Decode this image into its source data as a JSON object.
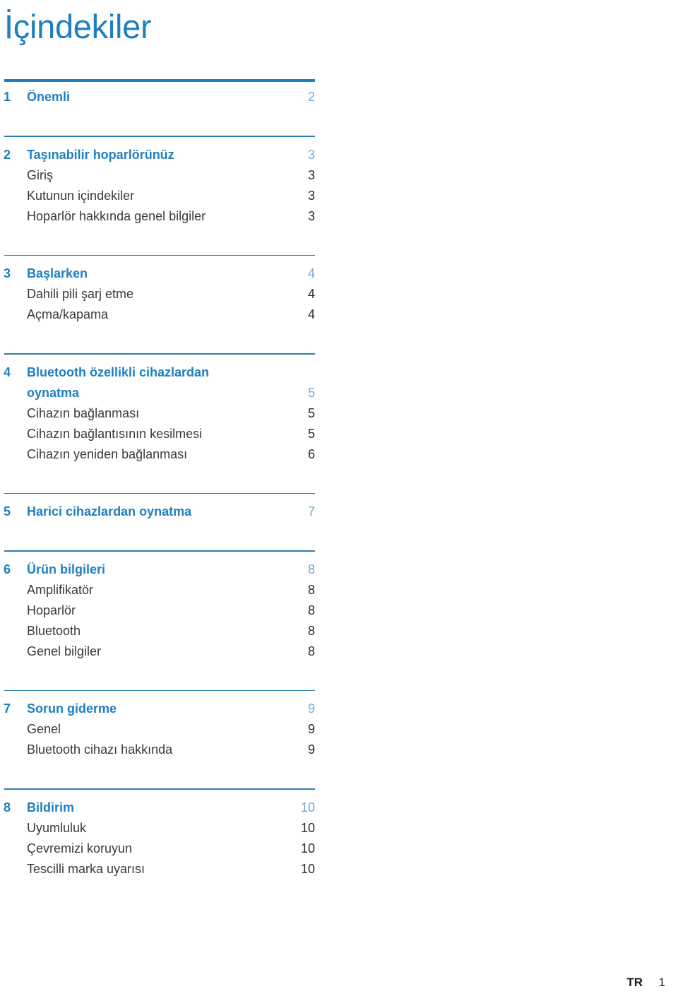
{
  "document": {
    "title": "İçindekiler",
    "accent_color": "#1f7fbf",
    "sub_text_color": "#3a3a3a",
    "chapter_page_color": "#6ea9cc"
  },
  "sections": [
    {
      "number": "1",
      "title": "Önemli",
      "page": "2",
      "title_line2": "",
      "entries": []
    },
    {
      "number": "2",
      "title": "Taşınabilir hoparlörünüz",
      "page": "3",
      "title_line2": "",
      "entries": [
        {
          "label": "Giriş",
          "page": "3"
        },
        {
          "label": "Kutunun içindekiler",
          "page": "3"
        },
        {
          "label": "Hoparlör hakkında genel bilgiler",
          "page": "3"
        }
      ]
    },
    {
      "number": "3",
      "title": "Başlarken",
      "page": "4",
      "title_line2": "",
      "entries": [
        {
          "label": "Dahili pili şarj etme",
          "page": "4"
        },
        {
          "label": "Açma/kapama",
          "page": "4"
        }
      ]
    },
    {
      "number": "4",
      "title": "Bluetooth özellikli cihazlardan",
      "title_line2": "oynatma",
      "page": "5",
      "entries": [
        {
          "label": "Cihazın bağlanması",
          "page": "5"
        },
        {
          "label": "Cihazın bağlantısının kesilmesi",
          "page": "5"
        },
        {
          "label": "Cihazın yeniden bağlanması",
          "page": "6"
        }
      ]
    },
    {
      "number": "5",
      "title": "Harici cihazlardan oynatma",
      "page": "7",
      "title_line2": "",
      "entries": []
    },
    {
      "number": "6",
      "title": "Ürün bilgileri",
      "page": "8",
      "title_line2": "",
      "entries": [
        {
          "label": "Amplifikatör",
          "page": "8"
        },
        {
          "label": "Hoparlör",
          "page": "8"
        },
        {
          "label": "Bluetooth",
          "page": "8"
        },
        {
          "label": "Genel bilgiler",
          "page": "8"
        }
      ]
    },
    {
      "number": "7",
      "title": "Sorun giderme",
      "page": "9",
      "title_line2": "",
      "entries": [
        {
          "label": "Genel",
          "page": "9"
        },
        {
          "label": "Bluetooth cihazı hakkında",
          "page": "9"
        }
      ]
    },
    {
      "number": "8",
      "title": "Bildirim",
      "page": "10",
      "title_line2": "",
      "entries": [
        {
          "label": "Uyumluluk",
          "page": "10"
        },
        {
          "label": "Çevremizi koruyun",
          "page": "10"
        },
        {
          "label": "Tescilli marka uyarısı",
          "page": "10"
        }
      ]
    }
  ],
  "footer": {
    "language": "TR",
    "page_number": "1"
  }
}
